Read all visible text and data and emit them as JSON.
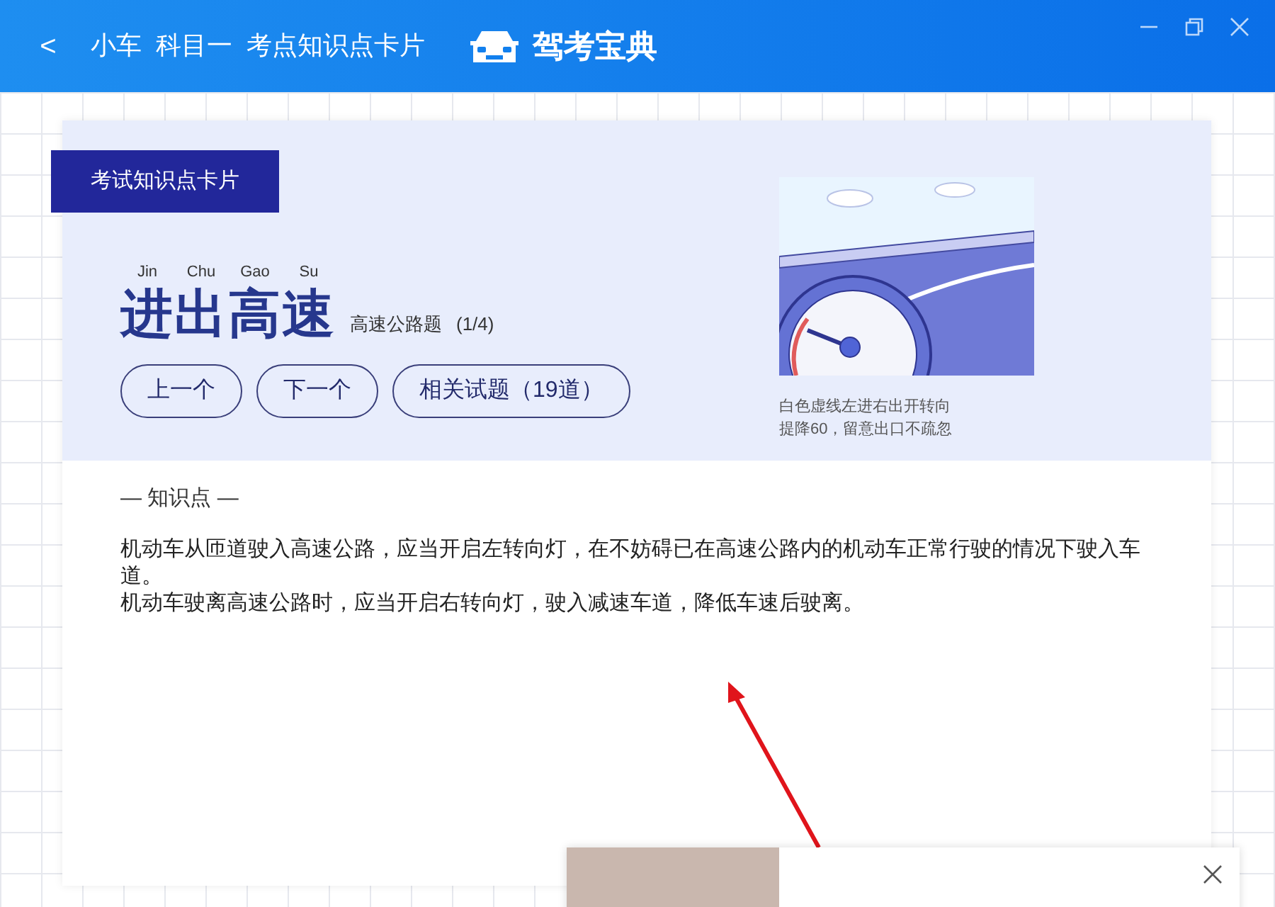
{
  "titlebar": {
    "back": "<",
    "breadcrumb": [
      "小车",
      "科目一",
      "考点知识点卡片"
    ],
    "logo_text": "驾考宝典"
  },
  "card": {
    "tag": "考试知识点卡片",
    "pinyin": [
      "Jin",
      "Chu",
      "Gao",
      "Su"
    ],
    "title": "进出高速",
    "subtitle": "高速公路题",
    "count": "(1/4)",
    "buttons": [
      "上一个",
      "下一个",
      "相关试题（19道）"
    ],
    "image_caption": [
      "白色虚线左进右出开转向",
      "提降60，留意出口不疏忽"
    ],
    "section_heading": "— 知识点 —",
    "paragraphs": [
      "机动车从匝道驶入高速公路，应当开启左转向灯，在不妨碍已在高速公路内的机动车正常行驶的情况下驶入车道。",
      "机动车驶离高速公路时，应当开启右转向灯，驶入减速车道，降低车速后驶离。"
    ]
  }
}
